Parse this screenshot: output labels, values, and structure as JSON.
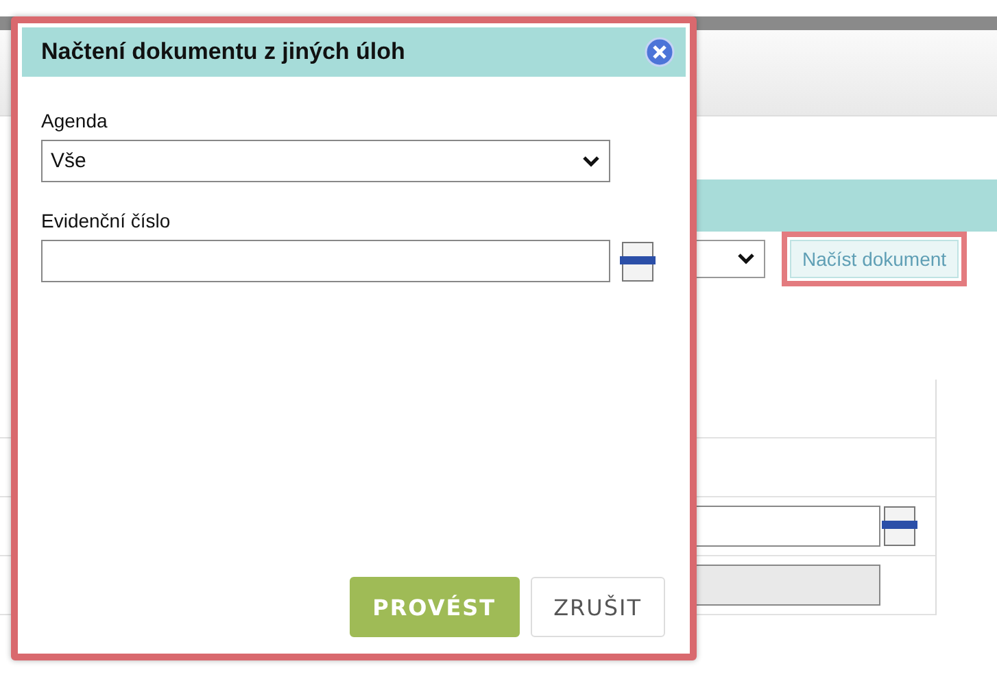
{
  "dialog": {
    "title": "Načtení dokumentu z jiných úloh",
    "fields": [
      {
        "kind": "select",
        "label": "Agenda",
        "value": "Vše"
      },
      {
        "kind": "text",
        "label": "Evidenční číslo"
      }
    ],
    "buttons": [
      {
        "label": "PROVÉST",
        "primary": true
      },
      {
        "label": "ZRUŠIT",
        "primary": false
      }
    ]
  },
  "background": {
    "load_button": "Načíst dokument"
  }
}
